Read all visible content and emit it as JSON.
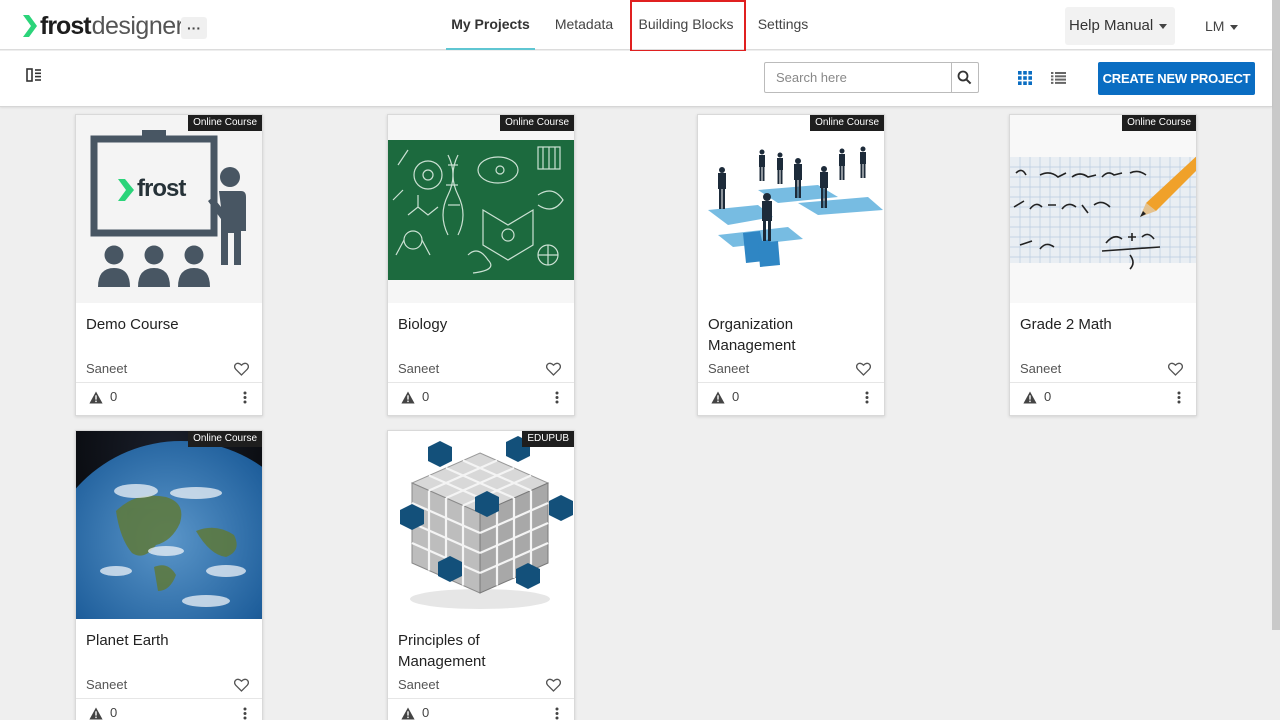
{
  "app": {
    "logo_primary": "frost",
    "logo_secondary": "designer",
    "more_label": "···",
    "accent": "#5fc6d2",
    "brand_blue": "#0a6dc2",
    "logo_green": "#2bd47a"
  },
  "nav": {
    "tabs": [
      {
        "label": "My Projects",
        "active": true
      },
      {
        "label": "Metadata",
        "active": false
      },
      {
        "label": "Building Blocks",
        "active": false,
        "highlighted": true
      },
      {
        "label": "Settings",
        "active": false
      }
    ],
    "help_label": "Help Manual",
    "user_label": "LM"
  },
  "toolbar": {
    "search_placeholder": "Search here",
    "create_label": "CREATE NEW PROJECT",
    "icons": [
      "sidebar-toggle-icon",
      "search-icon",
      "grid-view-icon",
      "list-view-icon"
    ]
  },
  "projects": [
    {
      "title": "Demo Course",
      "badge": "Online Course",
      "author": "Saneet",
      "warnings": "0",
      "thumbnail": "presentation-icon",
      "logo_text": "frost"
    },
    {
      "title": "Biology",
      "badge": "Online Course",
      "author": "Saneet",
      "warnings": "0",
      "thumbnail": "chalkboard-science-image"
    },
    {
      "title": "Organization Management",
      "badge": "Online Course",
      "author": "Saneet",
      "warnings": "0",
      "thumbnail": "puzzle-people-image"
    },
    {
      "title": "Grade 2 Math",
      "badge": "Online Course",
      "author": "Saneet",
      "warnings": "0",
      "thumbnail": "math-paper-pencil-image"
    },
    {
      "title": "Planet Earth",
      "badge": "Online Course",
      "author": "Saneet",
      "warnings": "0",
      "thumbnail": "earth-image"
    },
    {
      "title": "Principles of Management",
      "badge": "EDUPUB",
      "author": "Saneet",
      "warnings": "0",
      "thumbnail": "cube-blocks-image"
    }
  ]
}
